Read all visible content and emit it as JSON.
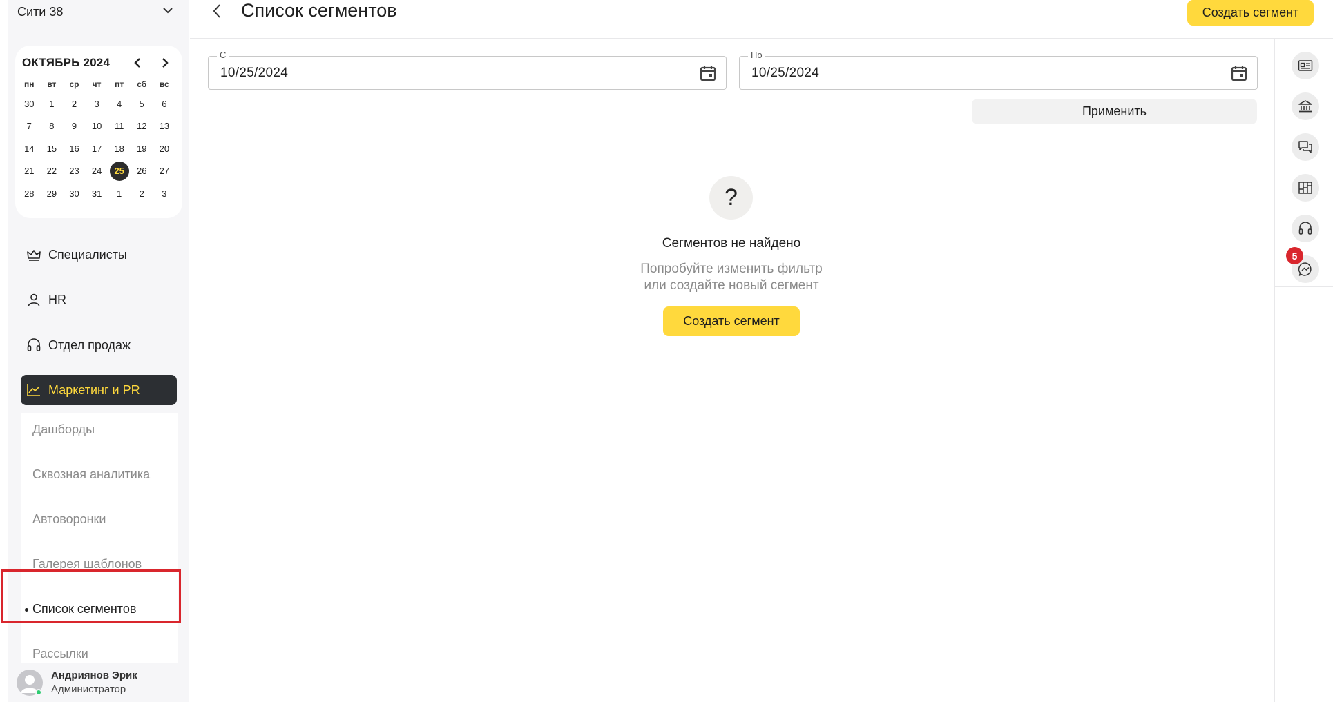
{
  "sidebar": {
    "city": "Сити 38",
    "calendar": {
      "title": "ОКТЯБРЬ 2024",
      "weekdays": [
        "пн",
        "вт",
        "ср",
        "чт",
        "пт",
        "сб",
        "вс"
      ],
      "weeks": [
        [
          "30",
          "1",
          "2",
          "3",
          "4",
          "5",
          "6"
        ],
        [
          "7",
          "8",
          "9",
          "10",
          "11",
          "12",
          "13"
        ],
        [
          "14",
          "15",
          "16",
          "17",
          "18",
          "19",
          "20"
        ],
        [
          "21",
          "22",
          "23",
          "24",
          "25",
          "26",
          "27"
        ],
        [
          "28",
          "29",
          "30",
          "31",
          "1",
          "2",
          "3"
        ]
      ],
      "today": "25"
    },
    "nav": [
      {
        "label": "Специалисты",
        "icon": "crown-icon"
      },
      {
        "label": "HR",
        "icon": "person-icon"
      },
      {
        "label": "Отдел продаж",
        "icon": "headset-icon"
      },
      {
        "label": "Маркетинг и PR",
        "icon": "chart-line-icon",
        "active": true
      }
    ],
    "sub_items": [
      {
        "label": "Дашборды"
      },
      {
        "label": "Сквозная аналитика"
      },
      {
        "label": "Автоворонки"
      },
      {
        "label": "Галерея шаблонов"
      },
      {
        "label": "Список сегментов",
        "current": true
      },
      {
        "label": "Рассылки"
      }
    ],
    "user": {
      "name": "Андриянов Эрик",
      "role": "Администратор"
    }
  },
  "header": {
    "title": "Список сегментов",
    "create_label": "Создать сегмент"
  },
  "filters": {
    "from_label": "С",
    "from_value": "10/25/2024",
    "to_label": "По",
    "to_value": "10/25/2024",
    "apply_label": "Применить"
  },
  "empty_state": {
    "icon": "?",
    "title": "Сегментов не найдено",
    "subtitle_line1": "Попробуйте изменить фильтр",
    "subtitle_line2": "или создайте новый сегмент",
    "create_label": "Создать сегмент"
  },
  "right_rail": {
    "buttons": [
      "id-card-icon",
      "bank-icon",
      "chat-bubbles-icon",
      "board-icon",
      "headset-icon",
      "messenger-icon"
    ],
    "badge": "5"
  },
  "colors": {
    "accent": "#ffd93d",
    "dark": "#2c2f33",
    "badge": "#d9262d",
    "online": "#2ecc71"
  }
}
